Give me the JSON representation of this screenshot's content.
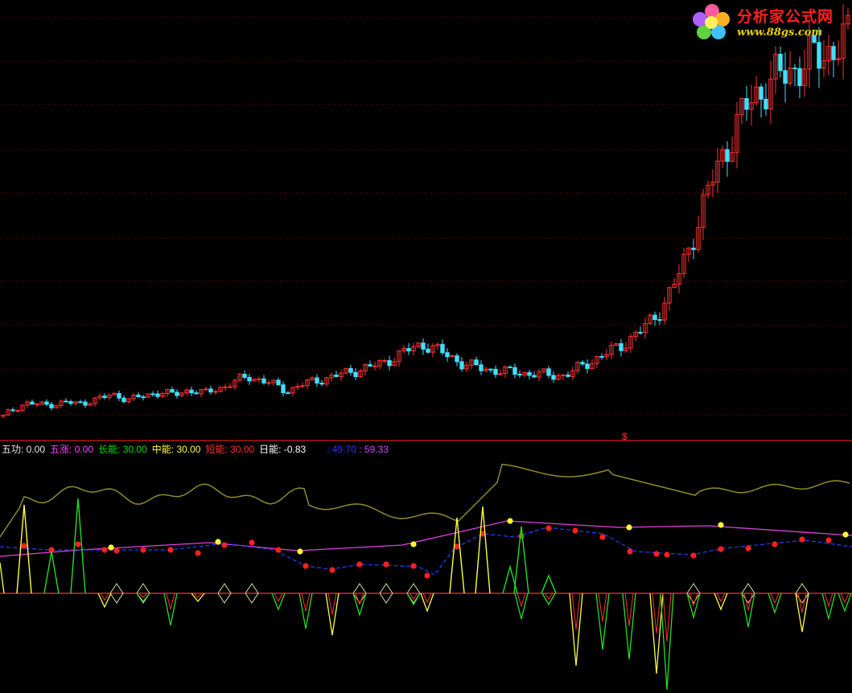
{
  "logo": {
    "title": "分析家公式网",
    "url": "www.88gs.com"
  },
  "marker": "$",
  "legend": [
    {
      "label": "五功:",
      "value": "0.00",
      "color": "#e8e8e8",
      "value_color": "#e8e8e8"
    },
    {
      "label": "五涨:",
      "value": "0.00",
      "color": "#ff40ff",
      "value_color": "#ff40ff"
    },
    {
      "label": "长能:",
      "value": "30.00",
      "color": "#00e000",
      "value_color": "#00e000"
    },
    {
      "label": "中能:",
      "value": "30.00",
      "color": "#ffff40",
      "value_color": "#ffff40"
    },
    {
      "label": "短能:",
      "value": "30.00",
      "color": "#ff3030",
      "value_color": "#ff3030"
    },
    {
      "label": "日能:",
      "value": "-0.83",
      "color": "#ffffff",
      "value_color": "#ffffff"
    }
  ],
  "legend_extra": [
    {
      "value": "49.70",
      "color": "#3030ff"
    },
    {
      "value": "59.33",
      "color": "#d040ff"
    }
  ],
  "colors": {
    "up_candle": "#ff3030",
    "down_candle": "#40e0ff",
    "grid": "#8b0000",
    "separator": "#b01818",
    "olive_line": "#8c8c2c",
    "magenta_line": "#e040e0",
    "blue_line": "#2040ff",
    "dot_red": "#ff2020",
    "dot_yellow": "#ffff30",
    "spike_green": "#20e020",
    "spike_yellow": "#ffff40",
    "spike_red": "#ff3030"
  },
  "chart_data": {
    "type": "candlestick",
    "price_closes": [
      0.52,
      0.58,
      0.62,
      0.66,
      0.68,
      0.67,
      0.66,
      0.66,
      0.67,
      0.68,
      0.69,
      0.68,
      0.67,
      0.69,
      0.72,
      0.73,
      0.75,
      0.78,
      0.77,
      0.75,
      0.73,
      0.74,
      0.76,
      0.78,
      0.8,
      0.82,
      0.8,
      0.78,
      0.8,
      0.83,
      0.84,
      0.82,
      0.8,
      0.83,
      0.86,
      0.88,
      0.92,
      0.95,
      0.98,
      1.0,
      0.98,
      0.96,
      0.94,
      0.9,
      0.86,
      0.83,
      0.86,
      0.9,
      0.92,
      0.94,
      0.96,
      0.98,
      1.0,
      1.02,
      1.04,
      1.06,
      1.08,
      1.1,
      1.12,
      1.14,
      1.16,
      1.2,
      1.24,
      1.28,
      1.32,
      1.35,
      1.38,
      1.4,
      1.36,
      1.32,
      1.28,
      1.24,
      1.2,
      1.16,
      1.14,
      1.12,
      1.1,
      1.09,
      1.08,
      1.07,
      1.06,
      1.06,
      1.05,
      1.04,
      1.04,
      1.03,
      1.03,
      1.02,
      1.02,
      1.02,
      1.05,
      1.1,
      1.14,
      1.18,
      1.22,
      1.26,
      1.3,
      1.34,
      1.38,
      1.44,
      1.5,
      1.56,
      1.62,
      1.7,
      1.8,
      1.92,
      2.06,
      2.22,
      2.4,
      2.62,
      2.85,
      3.08,
      3.3,
      3.5,
      3.68,
      3.84,
      4.0,
      4.16,
      4.3,
      4.4,
      4.48,
      4.54,
      4.6,
      4.66,
      4.7,
      4.74,
      4.78,
      4.82,
      4.86,
      4.9,
      4.94,
      4.98,
      5.02,
      5.06,
      5.1
    ],
    "indicators": [
      "五功",
      "五涨",
      "长能",
      "中能",
      "短能",
      "日能"
    ]
  }
}
